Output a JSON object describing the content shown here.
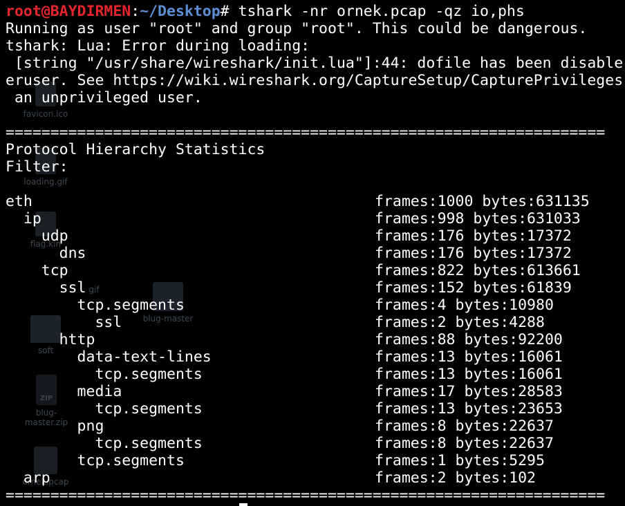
{
  "colors": {
    "background": "#000000",
    "text": "#ffffff",
    "prompt_user": "#e5242b",
    "prompt_path": "#5c8fd6"
  },
  "prompt": {
    "user_host": "root@BAYDIRMEN",
    "separator": ":",
    "path": "~/Desktop",
    "symbol": "#",
    "command": " tshark -nr ornek.pcap -qz io,phs"
  },
  "output_lines": [
    "Running as user \"root\" and group \"root\". This could be dangerous.",
    "tshark: Lua: Error during loading:",
    " [string \"/usr/share/wireshark/init.lua\"]:44: dofile has been disable",
    "eruser. See https://wiki.wireshark.org/CaptureSetup/CapturePrivileges",
    " an unprivileged user.",
    ""
  ],
  "separator_line": "===================================================================",
  "stats_title": "Protocol Hierarchy Statistics",
  "filter_label": "Filter:",
  "hierarchy": [
    {
      "protocol": "eth",
      "stats": "frames:1000 bytes:631135"
    },
    {
      "protocol": "  ip",
      "stats": "frames:998 bytes:631033"
    },
    {
      "protocol": "    udp",
      "stats": "frames:176 bytes:17372"
    },
    {
      "protocol": "      dns",
      "stats": "frames:176 bytes:17372"
    },
    {
      "protocol": "    tcp",
      "stats": "frames:822 bytes:613661"
    },
    {
      "protocol": "      ssl",
      "stats": "frames:152 bytes:61839"
    },
    {
      "protocol": "        tcp.segments",
      "stats": "frames:4 bytes:10980"
    },
    {
      "protocol": "          ssl",
      "stats": "frames:2 bytes:4288"
    },
    {
      "protocol": "      http",
      "stats": "frames:88 bytes:92200"
    },
    {
      "protocol": "        data-text-lines",
      "stats": "frames:13 bytes:16061"
    },
    {
      "protocol": "          tcp.segments",
      "stats": "frames:13 bytes:16061"
    },
    {
      "protocol": "        media",
      "stats": "frames:17 bytes:28583"
    },
    {
      "protocol": "          tcp.segments",
      "stats": "frames:13 bytes:23653"
    },
    {
      "protocol": "        png",
      "stats": "frames:8 bytes:22637"
    },
    {
      "protocol": "          tcp.segments",
      "stats": "frames:8 bytes:22637"
    },
    {
      "protocol": "        tcp.segments",
      "stats": "frames:1 bytes:5295"
    },
    {
      "protocol": "  arp",
      "stats": "frames:2 bytes:102"
    }
  ],
  "desktop_icons": [
    {
      "label": "favicon.ico",
      "icon": "image-file-icon"
    },
    {
      "label": "loading.gif",
      "icon": "gif-file-icon"
    },
    {
      "label": "flag.kin",
      "icon": "file-icon"
    },
    {
      "label": "gif",
      "icon": "file-icon"
    },
    {
      "label": "blug-master",
      "icon": "folder-icon"
    },
    {
      "label": "soft",
      "icon": "folder-icon"
    },
    {
      "label": "blug-master.zip",
      "icon": "zip-file-icon"
    },
    {
      "label": "ornek.pcap",
      "icon": "document-icon"
    }
  ]
}
